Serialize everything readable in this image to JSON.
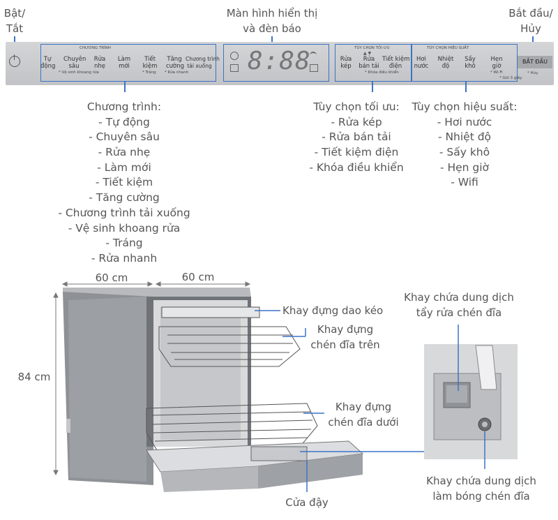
{
  "top_labels": {
    "power": [
      "Bật/",
      "Tắt"
    ],
    "display": [
      "Màn hình hiển thị",
      "và đèn báo"
    ],
    "start": [
      "Bắt đầu/",
      "Hủy"
    ]
  },
  "panel": {
    "programs_title": "CHƯƠNG TRÌNH",
    "programs": [
      [
        "Tự",
        "động"
      ],
      [
        "Chuyên",
        "sâu"
      ],
      [
        "Rửa",
        "nhẹ"
      ],
      [
        "Làm",
        "mới"
      ],
      [
        "Tiết",
        "kiệm"
      ],
      [
        "Tăng",
        "cường"
      ],
      [
        "Chương trình",
        "tải xuống"
      ]
    ],
    "program_notes": [
      "* Vệ sinh khoang rửa",
      "* Tráng",
      "* Rửa nhanh"
    ],
    "display_digits": "8:88",
    "options_title": "TÙY CHỌN TỐI ƯU",
    "options": [
      [
        "Rửa",
        "kép"
      ],
      [
        "Rửa",
        "bán tải"
      ],
      [
        "Tiết kiệm",
        "điện"
      ]
    ],
    "options_note": "* Khóa điều khiển",
    "perf_title": "TÙY CHỌN HIỆU SUẤT",
    "perf": [
      [
        "Hơi",
        "nước"
      ],
      [
        "Nhiệt",
        "độ"
      ],
      [
        "Sấy",
        "khô"
      ],
      [
        "Hẹn",
        "giờ"
      ]
    ],
    "perf_notes": [
      "* Wi-Fi",
      "* Giữ 3 giây"
    ],
    "start_button": "BẮT ĐẦU",
    "start_note": "* Hủy"
  },
  "programs_list": {
    "title": "Chương trình:",
    "items": [
      "- Tự động",
      "- Chuyên sâu",
      "- Rửa nhẹ",
      "- Làm mới",
      "- Tiết kiệm",
      "- Tăng cường",
      "- Chương trình tải xuống",
      "- Vệ sinh khoang rửa",
      "- Tráng",
      "- Rửa nhanh"
    ]
  },
  "options_list": {
    "title": "Tùy chọn tối ưu:",
    "items": [
      "- Rửa kép",
      "- Rửa bán tải",
      "- Tiết kiệm điện",
      "- Khóa điều khiển"
    ]
  },
  "perf_list": {
    "title": "Tùy chọn hiệu suất:",
    "items": [
      "- Hơi nước",
      "- Nhiệt độ",
      "- Sấy khô",
      "- Hẹn giờ",
      "- Wifi"
    ]
  },
  "dimensions": {
    "width": "60 cm",
    "depth": "60 cm",
    "height": "84 cm"
  },
  "parts": {
    "cutlery_tray": "Khay đựng dao kéo",
    "upper_rack": [
      "Khay đựng",
      "chén đĩa trên"
    ],
    "lower_rack": [
      "Khay đựng",
      "chén đĩa dưới"
    ],
    "door": "Cửa đậy",
    "detergent": [
      "Khay chứa dung dịch",
      "tẩy rửa chén đĩa"
    ],
    "rinse_aid": [
      "Khay chứa dung dịch",
      "làm bóng chén đĩa"
    ]
  },
  "colors": {
    "accent": "#3b73c7",
    "panel": "#c9cacc",
    "body": "#9a9da1",
    "text": "#555555"
  }
}
